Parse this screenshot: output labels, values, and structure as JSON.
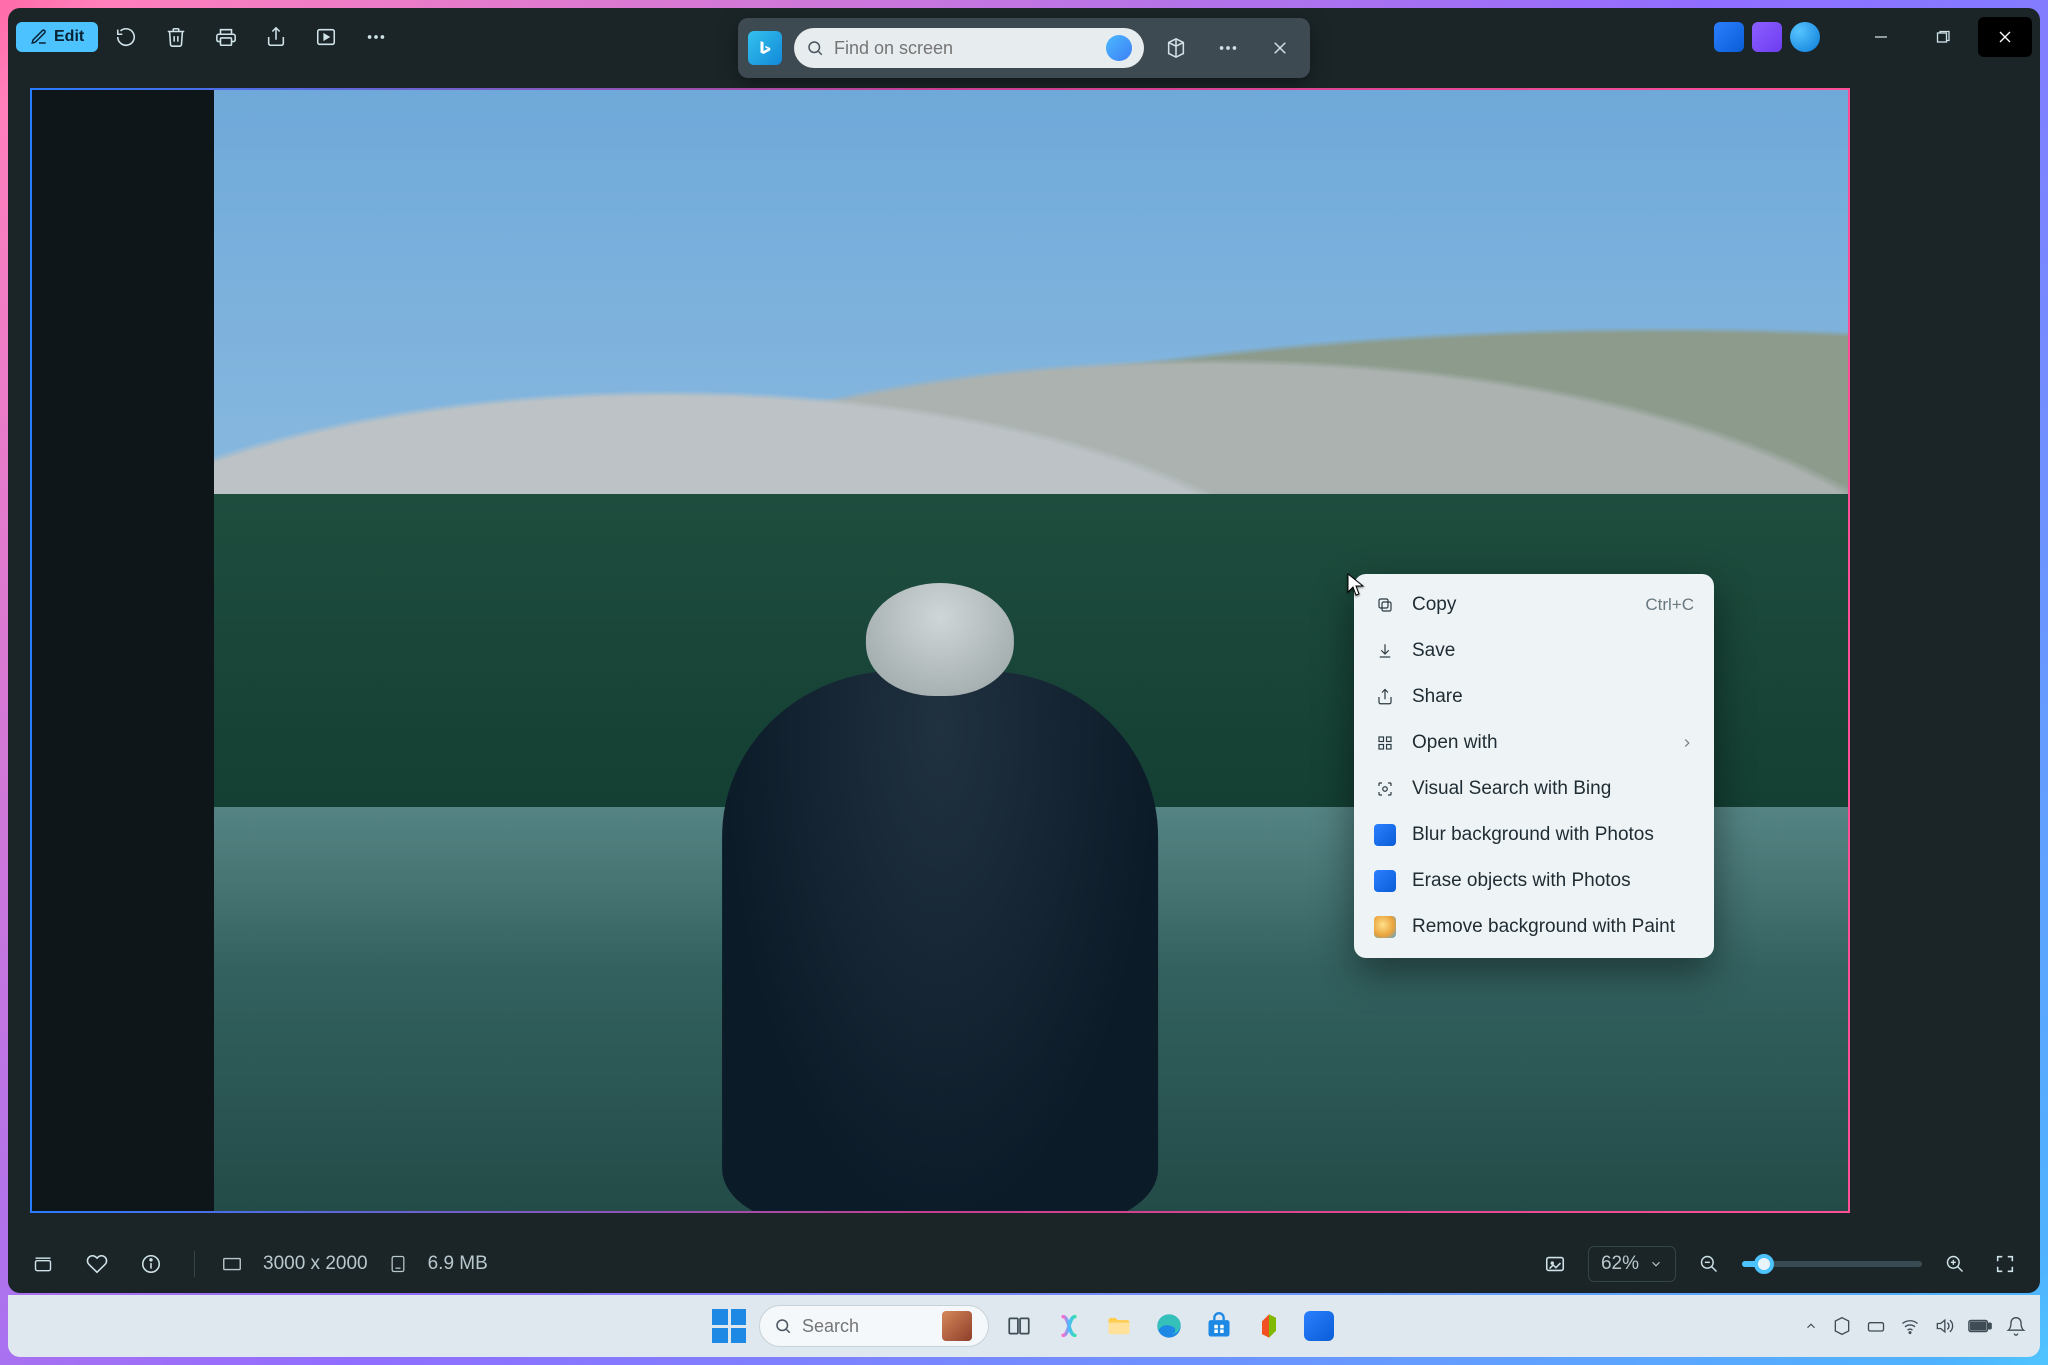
{
  "toolbar": {
    "edit_label": "Edit"
  },
  "search": {
    "placeholder": "Find on screen"
  },
  "context_menu": {
    "copy": "Copy",
    "copy_shortcut": "Ctrl+C",
    "save": "Save",
    "share": "Share",
    "open_with": "Open with",
    "visual_search": "Visual Search with Bing",
    "blur_bg": "Blur background with Photos",
    "erase_obj": "Erase objects with Photos",
    "remove_bg": "Remove background with Paint"
  },
  "status": {
    "dimensions": "3000 x 2000",
    "filesize": "6.9 MB",
    "zoom": "62%"
  },
  "taskbar": {
    "search_placeholder": "Search"
  }
}
